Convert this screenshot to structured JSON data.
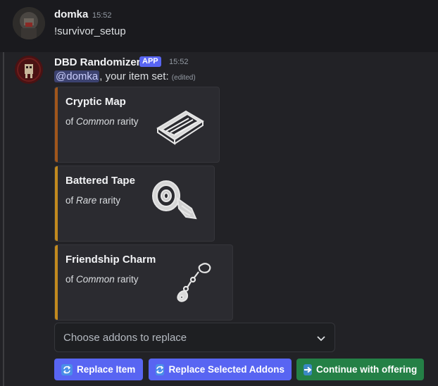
{
  "message1": {
    "username": "domka",
    "time": "15:52",
    "text": "!survivor_setup"
  },
  "message2": {
    "username": "DBD Randomizer",
    "badge": "APP",
    "time": "15:52",
    "mention": "@domka",
    "text": ", your item set: ",
    "edited": "(edited)"
  },
  "embeds": [
    {
      "title": "Cryptic Map",
      "prefix": "of ",
      "rarity": "Common",
      "suffix": " rarity",
      "accent": "#a1561b"
    },
    {
      "title": "Battered Tape",
      "prefix": "of ",
      "rarity": "Rare",
      "suffix": " rarity",
      "accent": "#c28a1e"
    },
    {
      "title": "Friendship Charm",
      "prefix": "of ",
      "rarity": "Common",
      "suffix": " rarity",
      "accent": "#c28a1e"
    }
  ],
  "select": {
    "placeholder": "Choose addons to replace"
  },
  "buttons": {
    "replace_item": "Replace Item",
    "replace_addons": "Replace Selected Addons",
    "continue": "Continue with offering"
  },
  "icons": {
    "replace_item": "repeat-icon",
    "replace_addons": "repeat-icon",
    "continue": "arrow-right-icon",
    "select": "chevron-down-icon"
  }
}
